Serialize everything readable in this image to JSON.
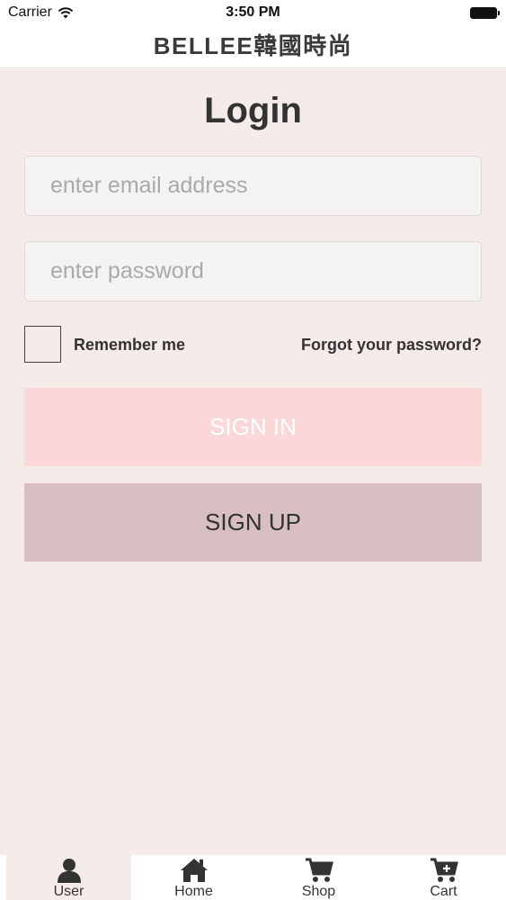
{
  "status_bar": {
    "carrier": "Carrier",
    "time": "3:50 PM"
  },
  "header": {
    "title": "BELLEE韓國時尚"
  },
  "login": {
    "title": "Login",
    "email_placeholder": "enter email address",
    "password_placeholder": "enter password",
    "remember_label": "Remember me",
    "forgot_label": "Forgot your password?",
    "signin_label": "SIGN IN",
    "signup_label": "SIGN UP"
  },
  "tabbar": {
    "items": [
      {
        "label": "User",
        "icon": "user-icon",
        "active": true
      },
      {
        "label": "Home",
        "icon": "home-icon",
        "active": false
      },
      {
        "label": "Shop",
        "icon": "shopping-cart-icon",
        "active": false
      },
      {
        "label": "Cart",
        "icon": "cart-add-icon",
        "active": false
      }
    ]
  },
  "colors": {
    "background": "#f5ece9",
    "signin_button": "#fcd7d7",
    "signup_button": "#d8bfc1"
  }
}
